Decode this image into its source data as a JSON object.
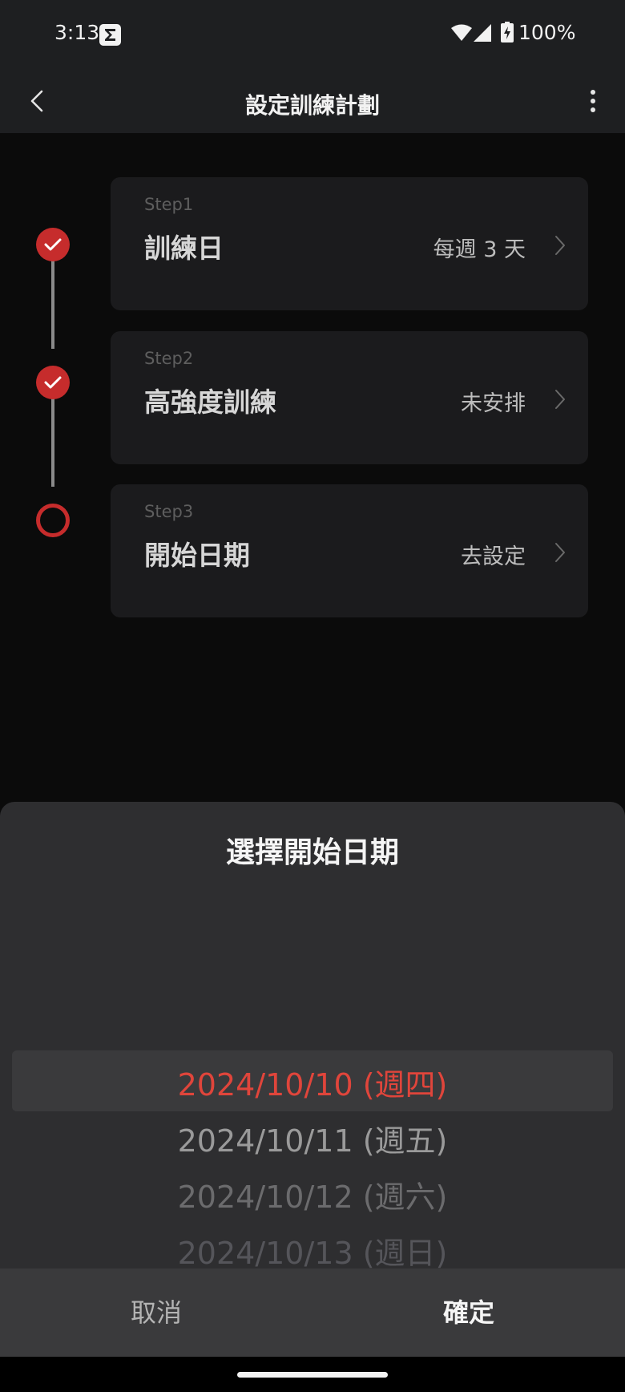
{
  "status_bar": {
    "time": "3:13",
    "battery": "100%",
    "icons": [
      "app-notification-icon",
      "wifi-icon",
      "signal-icon",
      "battery-charging-icon"
    ]
  },
  "header": {
    "title": "設定訓練計劃",
    "back_icon": "chevron-left-icon",
    "more_icon": "more-vertical-icon"
  },
  "steps": [
    {
      "label": "Step1",
      "title": "訓練日",
      "value": "每週 3 天",
      "status": "done"
    },
    {
      "label": "Step2",
      "title": "高強度訓練",
      "value": "未安排",
      "status": "done"
    },
    {
      "label": "Step3",
      "title": "開始日期",
      "value": "去設定",
      "status": "pending"
    }
  ],
  "sheet": {
    "title": "選擇開始日期",
    "options": [
      "2024/10/10 (週四)",
      "2024/10/11 (週五)",
      "2024/10/12 (週六)",
      "2024/10/13 (週日)"
    ],
    "selected": "2024/10/10 (週四)",
    "cancel_label": "取消",
    "confirm_label": "確定"
  },
  "colors": {
    "accent": "#c62c2c",
    "selected_text": "#e0453b",
    "background": "#0b0b0b",
    "card": "#1b1b1d",
    "sheet": "#2e2e30"
  }
}
